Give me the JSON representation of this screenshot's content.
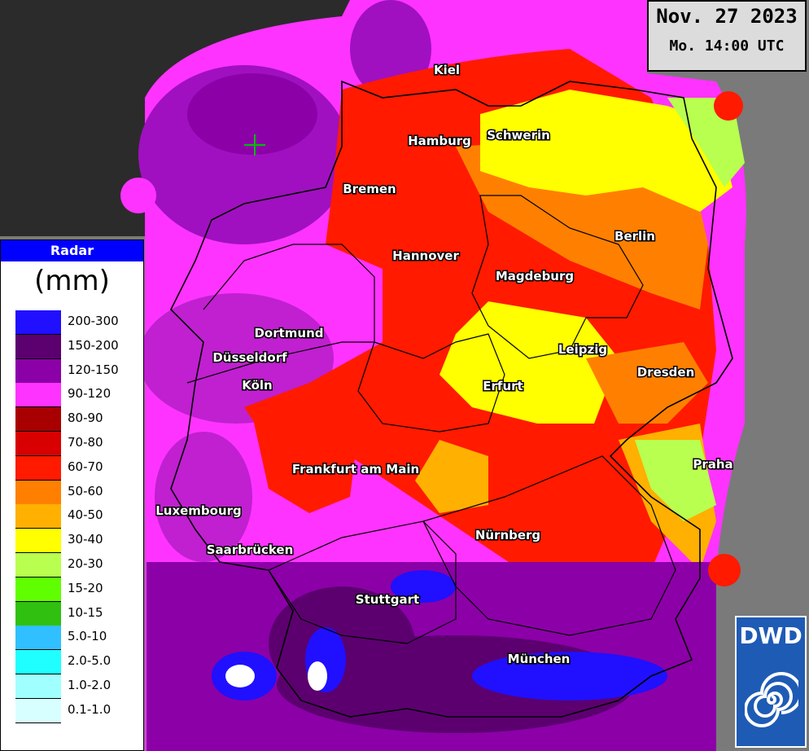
{
  "header": {
    "date": "Nov. 27 2023",
    "time": "Mo. 14:00 UTC"
  },
  "legend": {
    "title": "Radar",
    "unit": "(mm)",
    "items": [
      {
        "label": "200-300",
        "color": "#2010ff"
      },
      {
        "label": "150-200",
        "color": "#5c0070"
      },
      {
        "label": "120-150",
        "color": "#8c00a8"
      },
      {
        "label": "90-120",
        "color": "#ff33ff"
      },
      {
        "label": "80-90",
        "color": "#a80000"
      },
      {
        "label": "70-80",
        "color": "#d80000"
      },
      {
        "label": "60-70",
        "color": "#ff1a00"
      },
      {
        "label": "50-60",
        "color": "#ff8000"
      },
      {
        "label": "40-50",
        "color": "#ffb000"
      },
      {
        "label": "30-40",
        "color": "#ffff00"
      },
      {
        "label": "20-30",
        "color": "#b8ff50"
      },
      {
        "label": "15-20",
        "color": "#60ff00"
      },
      {
        "label": "10-15",
        "color": "#30c010"
      },
      {
        "label": "5.0-10",
        "color": "#30c0ff"
      },
      {
        "label": "2.0-5.0",
        "color": "#20ffff"
      },
      {
        "label": "1.0-2.0",
        "color": "#a0ffff"
      },
      {
        "label": "0.1-1.0",
        "color": "#d8ffff"
      }
    ]
  },
  "cities": {
    "kiel": "Kiel",
    "hamburg": "Hamburg",
    "schwerin": "Schwerin",
    "bremen": "Bremen",
    "berlin": "Berlin",
    "hannover": "Hannover",
    "magdeburg": "Magdeburg",
    "dortmund": "Dortmund",
    "duesseldorf": "Düsseldorf",
    "leipzig": "Leipzig",
    "dresden": "Dresden",
    "koeln": "Köln",
    "erfurt": "Erfurt",
    "praha": "Praha",
    "frankfurt": "Frankfurt am Main",
    "luxembourg": "Luxembourg",
    "nuernberg": "Nürnberg",
    "saarbruecken": "Saarbrücken",
    "stuttgart": "Stuttgart",
    "muenchen": "München"
  },
  "logo": {
    "text": "DWD"
  }
}
